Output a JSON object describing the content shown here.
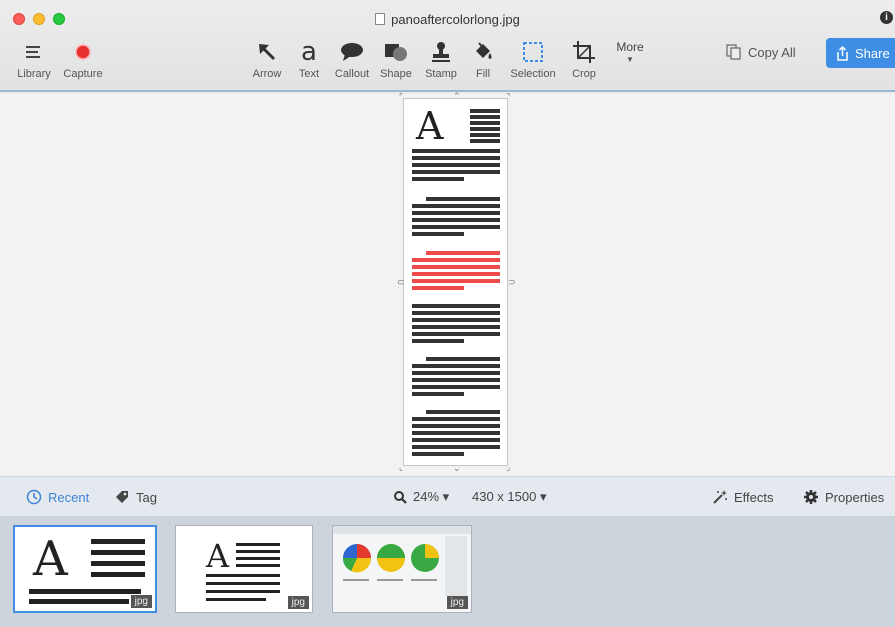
{
  "window": {
    "title": "panoaftercolorlong.jpg"
  },
  "toolbar": {
    "library": "Library",
    "capture": "Capture",
    "tools": [
      "Arrow",
      "Text",
      "Callout",
      "Shape",
      "Stamp",
      "Fill",
      "Selection",
      "Crop"
    ],
    "text_glyph": "a",
    "more": "More",
    "copy_all": "Copy All",
    "share": "Share"
  },
  "statusbar": {
    "recent": "Recent",
    "tag": "Tag",
    "zoom": "24% ▾",
    "dimensions": "430 x 1500 ▾",
    "effects": "Effects",
    "properties": "Properties"
  },
  "document": {
    "big_letter": "A"
  },
  "tray": {
    "items": [
      {
        "big_letter": "A",
        "badge": "jpg",
        "selected": true
      },
      {
        "big_letter": "A",
        "badge": "jpg",
        "selected": false
      },
      {
        "badge": "jpg",
        "selected": false
      }
    ]
  },
  "colors": {
    "accent": "#3e8ee5",
    "highlight_lines": "#ef4b4b",
    "capture": "#e8312f"
  }
}
